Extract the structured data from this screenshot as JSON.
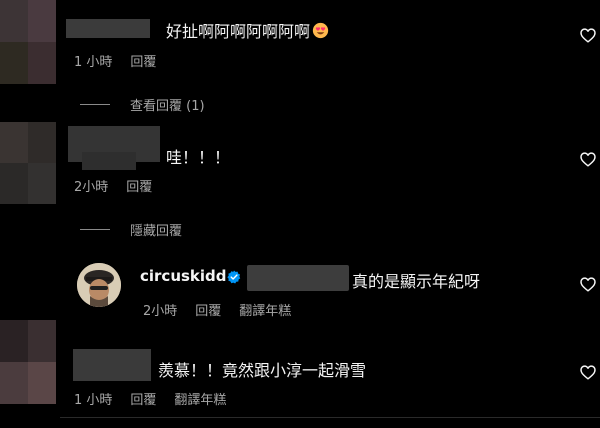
{
  "comments": [
    {
      "text": "好扯啊阿啊阿啊阿啊",
      "emoji": "heart-eyes-emoji",
      "time": "1 小時",
      "reply_label": "回覆"
    },
    {
      "text": "哇！！！",
      "time": "2小時",
      "reply_label": "回覆"
    },
    {
      "text": "羨慕！！竟然跟小淳一起滑雪",
      "time": "1 小時",
      "reply_label": "回覆",
      "translate_label": "翻譯年糕"
    }
  ],
  "view_replies": {
    "label": "查看回覆 (1)"
  },
  "hide_replies": {
    "label": "隱藏回覆"
  },
  "reply": {
    "username": "circuskidd",
    "text": "真的是顯示年紀呀",
    "time": "2小時",
    "reply_label": "回覆",
    "translate_label": "翻譯年糕"
  },
  "colors": {
    "background": "#000000",
    "verified": "#0095f6",
    "meta_text": "#a8a8a8"
  }
}
